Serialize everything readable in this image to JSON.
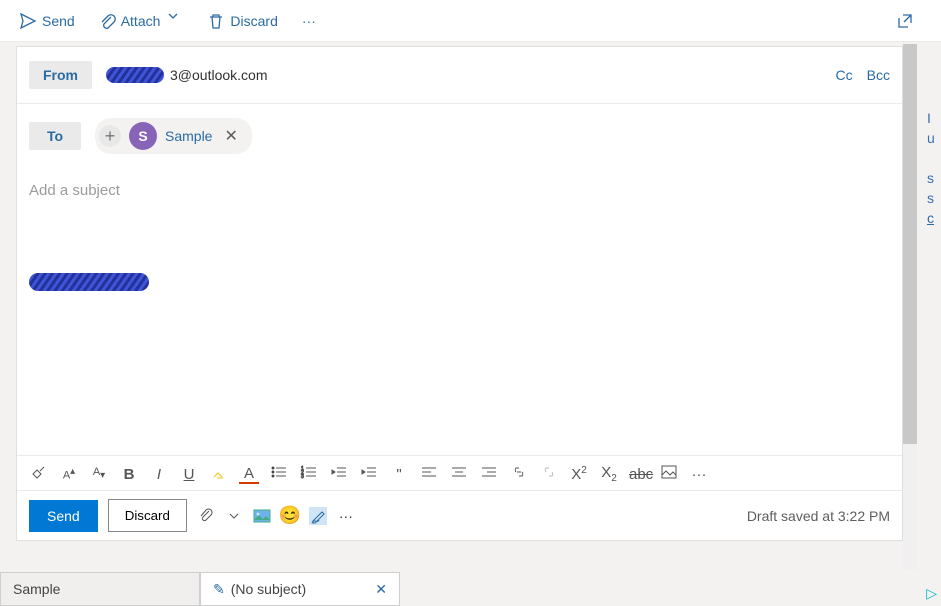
{
  "top": {
    "send": "Send",
    "attach": "Attach",
    "discard": "Discard"
  },
  "from": {
    "label": "From",
    "addrSuffix": "3@outlook.com",
    "cc": "Cc",
    "bcc": "Bcc"
  },
  "to": {
    "label": "To",
    "chipInitial": "S",
    "chipName": "Sample"
  },
  "subject": {
    "placeholder": "Add a subject"
  },
  "action": {
    "send": "Send",
    "discard": "Discard",
    "status": "Draft saved at 3:22 PM"
  },
  "tabs": {
    "tab1": "Sample",
    "tab2": "(No subject)"
  }
}
